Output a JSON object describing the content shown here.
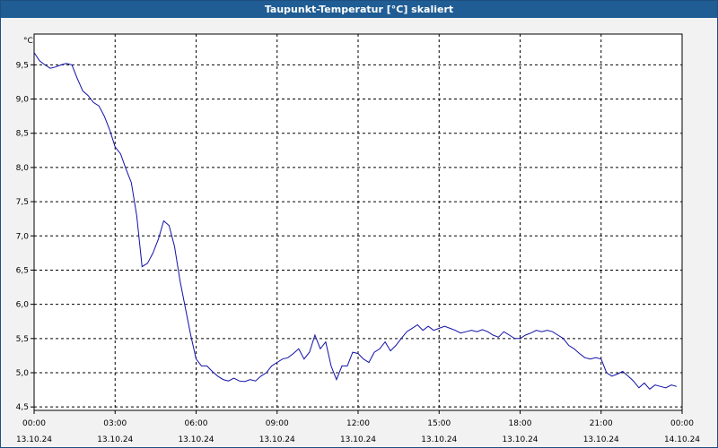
{
  "window": {
    "title": "Taupunkt-Temperatur [°C] skaliert"
  },
  "colors": {
    "title_bar": "#1f5d94",
    "line": "#1010a8",
    "grid": "#000000",
    "background": "#ffffff"
  },
  "chart_data": {
    "type": "line",
    "title": "Taupunkt-Temperatur [°C] skaliert",
    "ylabel": "°C",
    "xlabel": "",
    "grid": true,
    "grid_style": "dashed",
    "ylim": [
      4.45,
      9.95
    ],
    "xlim_hours": [
      0,
      24
    ],
    "y_ticks": [
      "4,5",
      "5,0",
      "5,5",
      "6,0",
      "6,5",
      "7,0",
      "7,5",
      "8,0",
      "8,5",
      "9,0",
      "9,5"
    ],
    "y_tick_values": [
      4.5,
      5.0,
      5.5,
      6.0,
      6.5,
      7.0,
      7.5,
      8.0,
      8.5,
      9.0,
      9.5
    ],
    "x_ticks": [
      {
        "time": "00:00",
        "date": "13.10.24"
      },
      {
        "time": "03:00",
        "date": "13.10.24"
      },
      {
        "time": "06:00",
        "date": "13.10.24"
      },
      {
        "time": "09:00",
        "date": "13.10.24"
      },
      {
        "time": "12:00",
        "date": "13.10.24"
      },
      {
        "time": "15:00",
        "date": "13.10.24"
      },
      {
        "time": "18:00",
        "date": "13.10.24"
      },
      {
        "time": "21:00",
        "date": "13.10.24"
      },
      {
        "time": "00:00",
        "date": "14.10.24"
      }
    ],
    "series": [
      {
        "color": "#1010a8",
        "x": [
          0.0,
          0.2,
          0.4,
          0.6,
          0.8,
          1.0,
          1.2,
          1.4,
          1.6,
          1.8,
          2.0,
          2.2,
          2.4,
          2.6,
          2.8,
          3.0,
          3.2,
          3.4,
          3.6,
          3.8,
          4.0,
          4.2,
          4.4,
          4.6,
          4.8,
          5.0,
          5.2,
          5.4,
          5.6,
          5.8,
          6.0,
          6.2,
          6.4,
          6.6,
          6.8,
          7.0,
          7.2,
          7.4,
          7.6,
          7.8,
          8.0,
          8.2,
          8.4,
          8.6,
          8.8,
          9.0,
          9.2,
          9.4,
          9.6,
          9.8,
          10.0,
          10.2,
          10.4,
          10.6,
          10.8,
          11.0,
          11.2,
          11.4,
          11.6,
          11.8,
          12.0,
          12.2,
          12.4,
          12.6,
          12.8,
          13.0,
          13.2,
          13.4,
          13.6,
          13.8,
          14.0,
          14.2,
          14.4,
          14.6,
          14.8,
          15.0,
          15.2,
          15.4,
          15.6,
          15.8,
          16.0,
          16.2,
          16.4,
          16.6,
          16.8,
          17.0,
          17.2,
          17.4,
          17.6,
          17.8,
          18.0,
          18.2,
          18.4,
          18.6,
          18.8,
          19.0,
          19.2,
          19.4,
          19.6,
          19.8,
          20.0,
          20.2,
          20.4,
          20.6,
          20.8,
          21.0,
          21.2,
          21.4,
          21.6,
          21.8,
          22.0,
          22.2,
          22.4,
          22.6,
          22.8,
          23.0,
          23.2,
          23.4,
          23.6,
          23.8
        ],
        "y": [
          9.68,
          9.56,
          9.5,
          9.45,
          9.47,
          9.5,
          9.52,
          9.5,
          9.3,
          9.12,
          9.05,
          8.95,
          8.9,
          8.75,
          8.55,
          8.3,
          8.2,
          7.98,
          7.78,
          7.3,
          6.55,
          6.6,
          6.75,
          6.95,
          7.22,
          7.15,
          6.85,
          6.35,
          5.95,
          5.55,
          5.2,
          5.1,
          5.1,
          5.02,
          4.95,
          4.9,
          4.88,
          4.92,
          4.88,
          4.87,
          4.9,
          4.88,
          4.95,
          5.0,
          5.1,
          5.15,
          5.2,
          5.22,
          5.28,
          5.35,
          5.2,
          5.3,
          5.55,
          5.35,
          5.45,
          5.1,
          4.9,
          5.1,
          5.1,
          5.3,
          5.28,
          5.2,
          5.15,
          5.3,
          5.35,
          5.45,
          5.32,
          5.4,
          5.5,
          5.6,
          5.65,
          5.7,
          5.62,
          5.68,
          5.62,
          5.65,
          5.68,
          5.65,
          5.62,
          5.58,
          5.6,
          5.62,
          5.6,
          5.63,
          5.6,
          5.55,
          5.52,
          5.6,
          5.55,
          5.5,
          5.5,
          5.55,
          5.58,
          5.62,
          5.6,
          5.62,
          5.6,
          5.55,
          5.5,
          5.4,
          5.35,
          5.28,
          5.22,
          5.2,
          5.22,
          5.2,
          5.0,
          4.95,
          4.98,
          5.02,
          4.95,
          4.88,
          4.78,
          4.85,
          4.76,
          4.82,
          4.8,
          4.78,
          4.82,
          4.8
        ]
      }
    ]
  }
}
